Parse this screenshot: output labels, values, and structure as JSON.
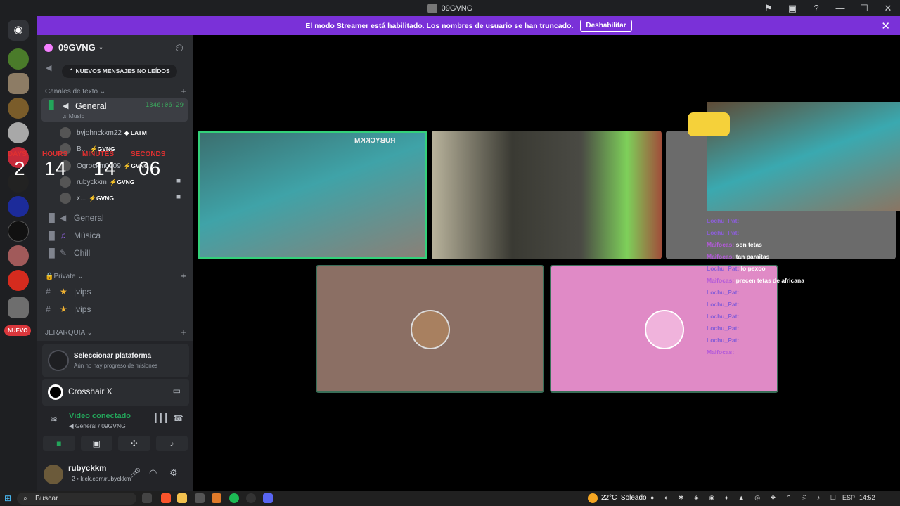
{
  "window": {
    "title": "09GVNG"
  },
  "banner": {
    "text": "El modo Streamer está habilitado. Los nombres de usuario se han truncado.",
    "button": "Deshabilitar"
  },
  "guilds": {
    "new_badge": "NUEVO"
  },
  "server": {
    "name": "09GVNG",
    "unread_pill": "NUEVOS MENSAJES NO LEÍDOS"
  },
  "categories": {
    "text": "Canales de texto",
    "private": "Private",
    "hierarchy": "JERARQUIA"
  },
  "voice_channel": {
    "name": "General",
    "sub": "Music",
    "timer": "1346:06:29"
  },
  "voice_users": [
    {
      "name": "byjohnckkm22",
      "tag": "LATM"
    },
    {
      "name": "B...",
      "tag": "GVNG"
    },
    {
      "name": "Ogrockm0909",
      "tag": "GVNG"
    },
    {
      "name": "rubyckkm",
      "tag": "GVNG"
    },
    {
      "name": "x...",
      "tag": "GVNG"
    }
  ],
  "countdown": {
    "days_label": "DAYS",
    "hours_label": "HOURS",
    "minutes_label": "MINUTES",
    "seconds_label": "SECONDS",
    "days": "2",
    "hours": "14",
    "minutes": "14",
    "seconds": "06"
  },
  "channels": [
    {
      "name": "General"
    },
    {
      "name": "Música"
    },
    {
      "name": "Chill"
    },
    {
      "name": "vips"
    },
    {
      "name": "vips"
    }
  ],
  "quest": {
    "title": "Seleccionar plataforma",
    "subtitle": "Aún no hay progreso de misiones"
  },
  "activity": {
    "name": "Crosshair X"
  },
  "voice_status": {
    "title": "Vídeo conectado",
    "subtitle": "General / 09GVNG"
  },
  "user": {
    "name": "rubyckkm",
    "status": "+2 • kick.com/rubyckkm"
  },
  "chat": [
    {
      "user": "Lochu_Pat:",
      "msg": ""
    },
    {
      "user": "Lochu_Pat:",
      "msg": ""
    },
    {
      "user": "Maifocas:",
      "msg": "son tetas"
    },
    {
      "user": "Maifocas:",
      "msg": "tan paraitas"
    },
    {
      "user": "Lochu_Pat:",
      "msg": "lo pexoo"
    },
    {
      "user": "Maifocas:",
      "msg": "precen tetas de africana"
    },
    {
      "user": "Lochu_Pat:",
      "msg": ""
    },
    {
      "user": "Lochu_Pat:",
      "msg": ""
    },
    {
      "user": "Lochu_Pat:",
      "msg": ""
    },
    {
      "user": "Lochu_Pat:",
      "msg": ""
    },
    {
      "user": "Lochu_Pat:",
      "msg": ""
    },
    {
      "user": "Maifocas:",
      "msg": ""
    }
  ],
  "stream_overlay": {
    "label": "RUBYCKKM"
  },
  "taskbar": {
    "search": "Buscar",
    "weather_temp": "22°C",
    "weather_text": "Soleado",
    "lang": "ESP",
    "time": "14:52"
  },
  "colors": {
    "accent": "#7a31d8",
    "online": "#23a55a",
    "danger": "#da373c"
  }
}
